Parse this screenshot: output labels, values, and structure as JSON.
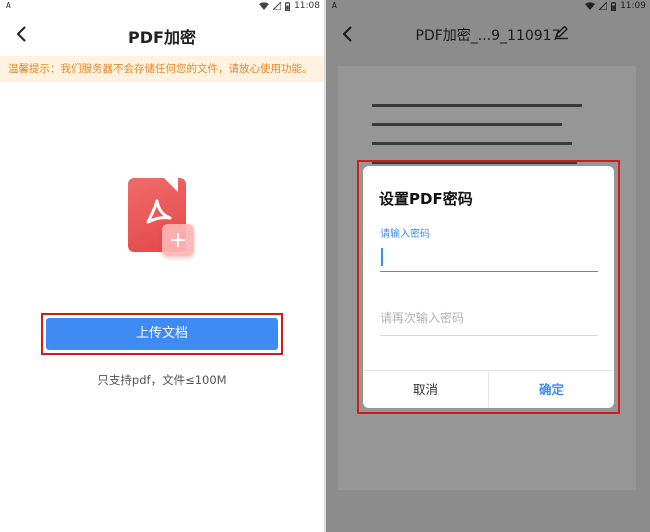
{
  "left_screen": {
    "status": {
      "left_badge": "A",
      "time": "11:08"
    },
    "header": {
      "title": "PDF加密"
    },
    "notice": "温馨提示：我们服务器不会存储任何您的文件，请放心使用功能。",
    "upload_button": "上传文档",
    "support_note": "只支持pdf，文件≤100M"
  },
  "right_screen": {
    "status": {
      "left_badge": "A",
      "time": "11:09"
    },
    "header": {
      "title": "PDF加密_...9_110917"
    },
    "dialog": {
      "title": "设置PDF密码",
      "password_label": "请输入密码",
      "password_value": "",
      "confirm_placeholder": "请再次输入密码",
      "cancel": "取消",
      "confirm": "确定"
    }
  },
  "colors": {
    "accent": "#3e8cf3",
    "highlight": "#d21c1c",
    "notice_bg": "#fff2e0",
    "notice_text": "#e4892b",
    "pdf_red": "#e24848"
  }
}
